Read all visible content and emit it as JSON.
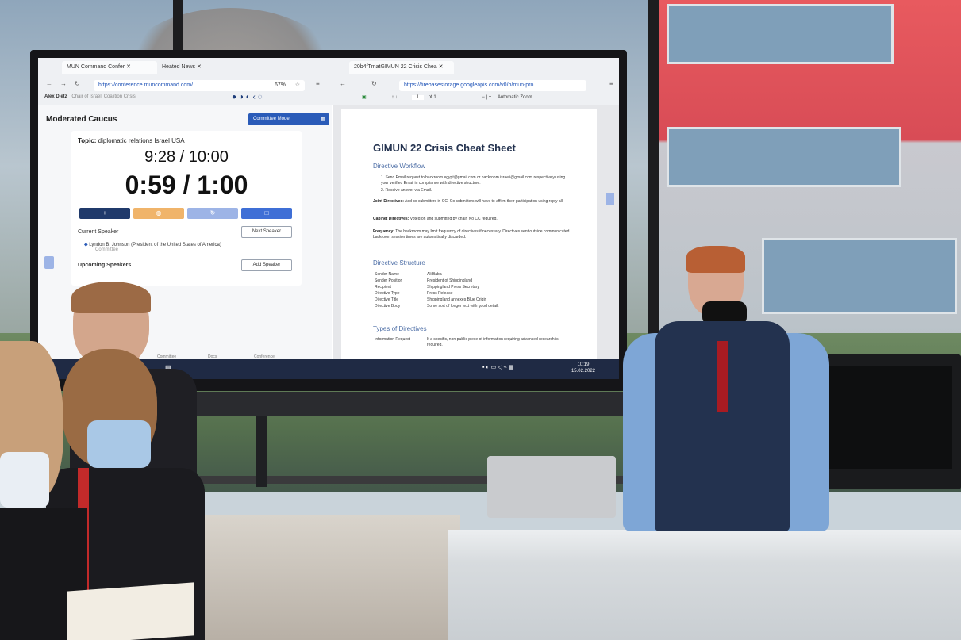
{
  "browser": {
    "tab1": "MUN Command Confer",
    "tab2": "Heated News",
    "tab3": "20b4fTmatGIMUN 22 Crisis Chea",
    "url_left": "https://conference.muncommand.com/",
    "zoom_left": "67%",
    "url_right": "https://firebasestorage.googleapis.com/v0/b/mun-pro",
    "pdf_page": "1",
    "pdf_of": "of 1",
    "pdf_zoom": "Automatic Zoom"
  },
  "left_app": {
    "user_name": "Alex Dietz",
    "user_role": "Chair of Israeli Coalition Crisis",
    "title": "Moderated Caucus",
    "committee_mode": "Committee Mode",
    "topic_label": "Topic:",
    "topic": "diplomatic relations Israel USA",
    "total_timer": "9:28 / 10:00",
    "speaker_timer": "0:59 / 1:00",
    "current_speaker_label": "Current Speaker",
    "next_speaker": "Next Speaker",
    "current_speaker": "Lyndon B. Johnson (President of the United States of America)",
    "current_speaker_sub": "Committee",
    "upcoming_label": "Upcoming Speakers",
    "add_speaker": "Add Speaker",
    "nav": [
      "Committee",
      "Docs",
      "Conference"
    ]
  },
  "pdf": {
    "title": "GIMUN 22 Crisis Cheat Sheet",
    "workflow_heading": "Directive Workflow",
    "workflow_1": "1.  Send Email request to backroom.egypt@gmail.com or backroom.israeli@gmail.com respectively using your verified Email in compliance with directive structure.",
    "workflow_2": "2.  Receive answer via Email.",
    "joint_label": "Joint Directives:",
    "joint_text": "Add co submitters in CC. Co submitters will have to affirm their participation using reply all.",
    "cabinet_label": "Cabinet Directives:",
    "cabinet_text": "Voted on and submitted by chair. No CC required.",
    "freq_label": "Frequency:",
    "freq_text": "The backroom may limit frequency of directives if necessary. Directives sent outside communicated backroom session times are automatically discarded.",
    "structure_heading": "Directive Structure",
    "structure": [
      {
        "k": "Sender Name",
        "v": "Ali Baba"
      },
      {
        "k": "Sender Position",
        "v": "President of Shippingland"
      },
      {
        "k": "Recipient",
        "v": "Shippingland Press Secretary"
      },
      {
        "k": "Directive Type",
        "v": "Press Release"
      },
      {
        "k": "Directive Title",
        "v": "Shippingland annexes Blue Origin"
      },
      {
        "k": "Directive Body",
        "v": "Some sort of longer text with good detail."
      }
    ],
    "types_heading": "Types of Directives",
    "info_request_k": "Information Request",
    "info_request_v": "If a specific, non-public piece of information requiring advanced research is required."
  },
  "taskbar": {
    "time": "10:19",
    "date": "15.02.2022"
  },
  "colors": {
    "accent_blue": "#2a5bb8",
    "btn_dark": "#203a6b",
    "btn_orange": "#f0b46a",
    "btn_light": "#9db4e6",
    "btn_blue": "#3f6fd6",
    "pdf_title": "#23324f"
  },
  "icons": [
    "back-icon",
    "forward-icon",
    "reload-icon",
    "star-icon",
    "menu-icon",
    "plus-icon",
    "pause-icon",
    "reset-icon",
    "stop-icon",
    "grid-icon",
    "windows-icon"
  ]
}
